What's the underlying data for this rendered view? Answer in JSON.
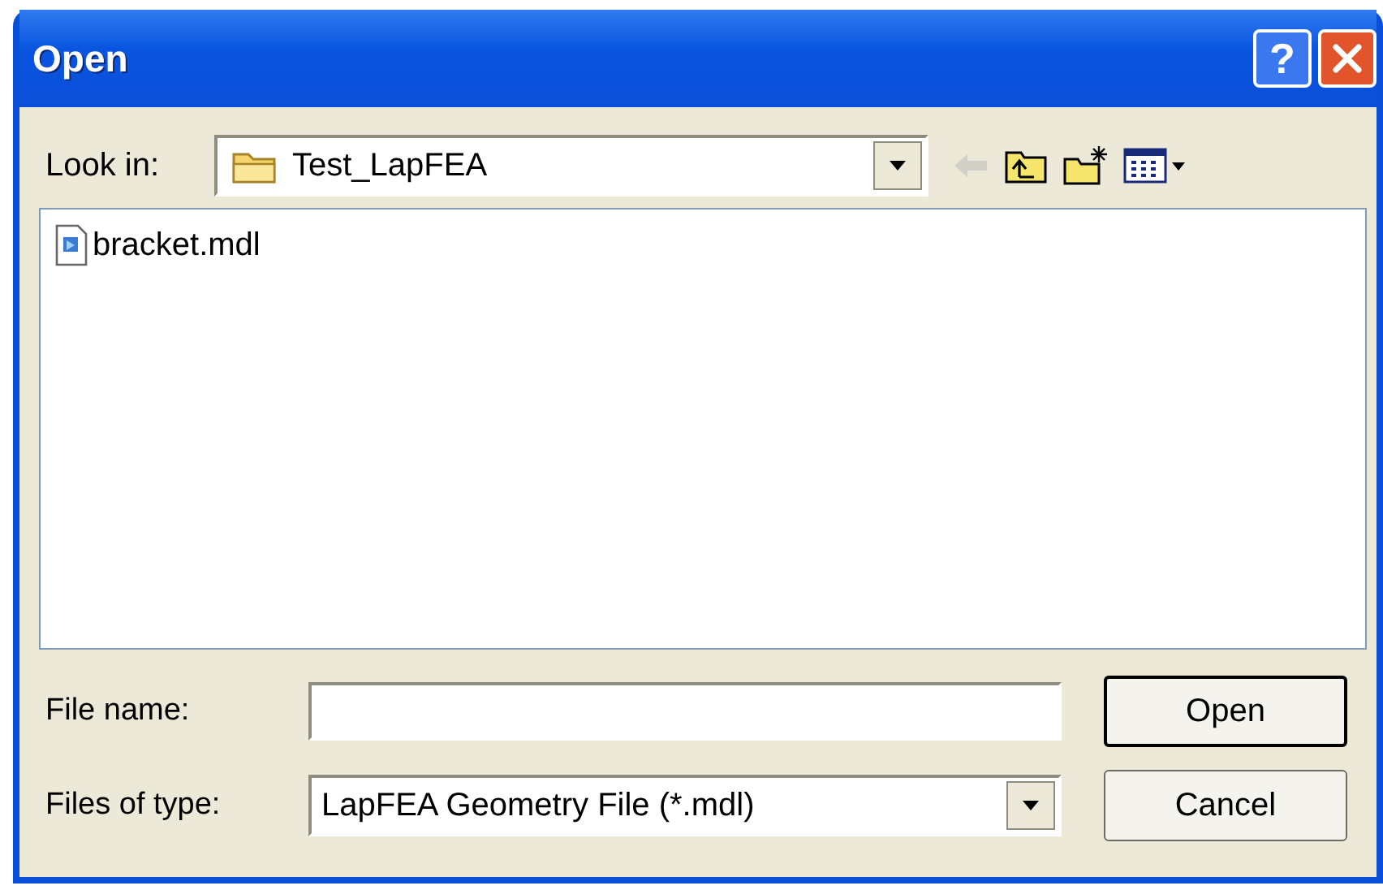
{
  "window": {
    "title": "Open"
  },
  "title_buttons": [
    {
      "kind": "help",
      "label": "?"
    },
    {
      "kind": "close"
    }
  ],
  "look_in": {
    "label": "Look in:",
    "value": "Test_LapFEA"
  },
  "toolbar": [
    {
      "kind": "back",
      "disabled": true
    },
    {
      "kind": "up",
      "disabled": false
    },
    {
      "kind": "new_folder",
      "disabled": false
    },
    {
      "kind": "views",
      "disabled": false
    }
  ],
  "files": [
    {
      "name": "bracket.mdl",
      "selected": false
    }
  ],
  "file_name": {
    "label": "File name:"
  },
  "file_type": {
    "label": "Files of type:",
    "value": "LapFEA Geometry File (*.mdl)"
  },
  "buttons": [
    {
      "label": "Open",
      "default": true
    },
    {
      "label": "Cancel",
      "default": false
    }
  ]
}
